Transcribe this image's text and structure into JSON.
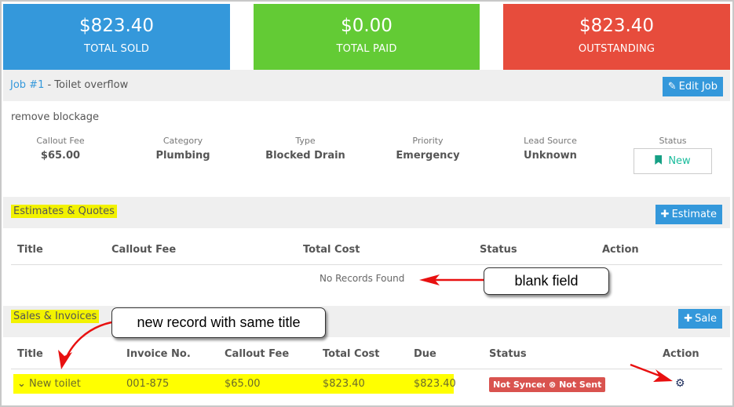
{
  "summary": [
    {
      "amount": "$823.40",
      "label": "TOTAL SOLD",
      "color": "#3498db"
    },
    {
      "amount": "$0.00",
      "label": "TOTAL PAID",
      "color": "#63cb35"
    },
    {
      "amount": "$823.40",
      "label": "OUTSTANDING",
      "color": "#e74c3c"
    }
  ],
  "job": {
    "link": "Job #1",
    "title": " - Toilet overflow",
    "edit_label": "Edit Job",
    "description": "remove blockage",
    "meta": [
      {
        "key": "Callout Fee",
        "value": "$65.00"
      },
      {
        "key": "Category",
        "value": "Plumbing"
      },
      {
        "key": "Type",
        "value": "Blocked Drain"
      },
      {
        "key": "Priority",
        "value": "Emergency"
      },
      {
        "key": "Lead Source",
        "value": "Unknown"
      }
    ],
    "status_label": "Status",
    "status_value": "New"
  },
  "estimates": {
    "title": "Estimates & Quotes",
    "add_label": "Estimate",
    "columns": [
      "Title",
      "Callout Fee",
      "Total Cost",
      "Status",
      "Action"
    ],
    "empty_text": "No Records Found"
  },
  "sales": {
    "title": "Sales & Invoices",
    "add_label": "Sale",
    "columns": [
      "Title",
      "Invoice No.",
      "Callout Fee",
      "Total Cost",
      "Due",
      "Status",
      "Action"
    ],
    "rows": [
      {
        "title": "New toilet",
        "invoice": "001-875",
        "callout_fee": "$65.00",
        "total_cost": "$823.40",
        "due": "$823.40",
        "badges": [
          "Not Synced",
          "Not Sent"
        ]
      }
    ]
  },
  "annotations": {
    "blank_field": "blank field",
    "same_title": "new record with same title"
  }
}
